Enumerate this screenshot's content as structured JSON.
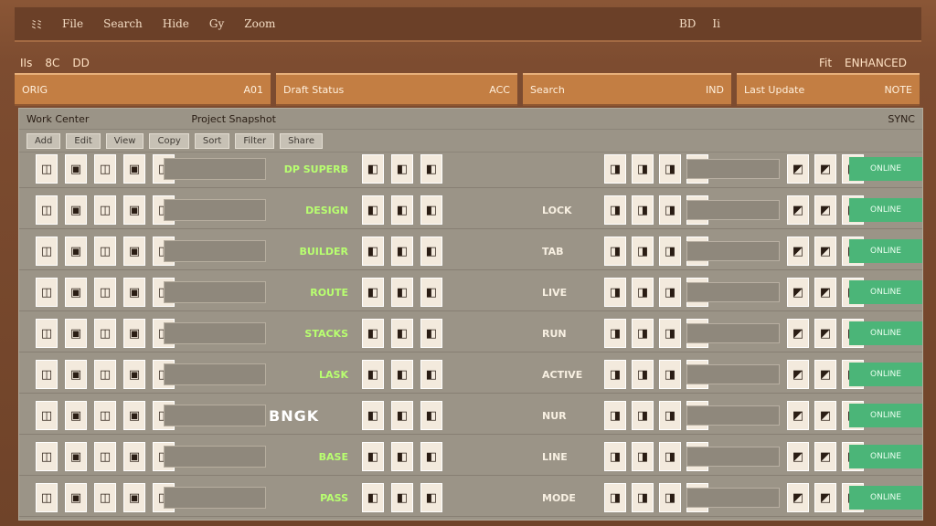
{
  "menu": {
    "items": [
      "ﾐﾐ",
      "File",
      "Search",
      "Hide",
      "Gy",
      "Zoom"
    ],
    "right": [
      "BD",
      "Ii"
    ]
  },
  "strip": {
    "left": [
      "IIs",
      "8C",
      "DD"
    ],
    "right": [
      "Fit",
      "ENHANCED"
    ]
  },
  "orange": {
    "boxes": [
      {
        "left": "ORIG",
        "right": "A01"
      },
      {
        "left": "Draft Status",
        "right": "ACC"
      },
      {
        "left": "Search",
        "right": "IND"
      },
      {
        "left": "Last Update",
        "right": "NOTE"
      }
    ]
  },
  "panel": {
    "title_left": "Work Center",
    "title_mid": "Project Snapshot",
    "title_right": "SYNC",
    "tools": [
      "Add",
      "Edit",
      "View",
      "Copy",
      "Sort",
      "Filter",
      "Share"
    ]
  },
  "rows": [
    {
      "green": "DP SUPERB",
      "mid": "",
      "right_green": "ONLINE"
    },
    {
      "green": "DESIGN",
      "mid": "LOCK",
      "right_green": "ONLINE"
    },
    {
      "green": "BUILDER",
      "mid": "TAB",
      "right_green": "ONLINE"
    },
    {
      "green": "ROUTE",
      "mid": "LIVE",
      "right_green": "ONLINE"
    },
    {
      "green": "STACKS",
      "mid": "RUN",
      "right_green": "ONLINE"
    },
    {
      "green": "LASK",
      "mid": "ACTIVE",
      "right_green": "ONLINE"
    },
    {
      "green": "",
      "mid": "NUR",
      "center": "BNGK",
      "right_green": "ONLINE"
    },
    {
      "green": "BASE",
      "mid": "LINE",
      "right_green": "ONLINE"
    },
    {
      "green": "PASS",
      "mid": "MODE",
      "right_green": "ONLINE"
    }
  ]
}
